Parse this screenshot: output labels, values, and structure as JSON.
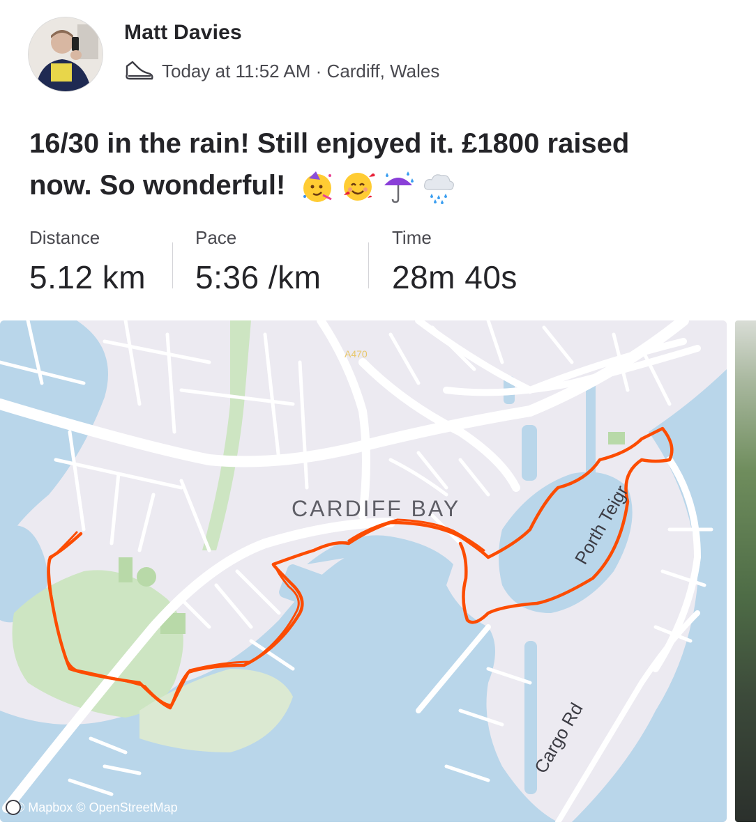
{
  "athlete": {
    "name": "Matt Davies",
    "meta": "Today at 11:52 AM · Cardiff, Wales"
  },
  "activity": {
    "title_line1": "16/30 in the rain! Still enjoyed it. £1800 raised",
    "title_line2": "now. So wonderful!",
    "emojis": [
      "partying-face",
      "smiling-face-with-hearts",
      "umbrella-with-rain-drops",
      "cloud-with-rain"
    ]
  },
  "stats": [
    {
      "label": "Distance",
      "value": "5.12 km"
    },
    {
      "label": "Pace",
      "value": "5:36 /km"
    },
    {
      "label": "Time",
      "value": "28m 40s"
    }
  ],
  "map": {
    "place_label": "CARDIFF BAY",
    "road_labels": {
      "a470": "A470",
      "porth_teigr": "Porth Teigr",
      "cargo_rd": "Cargo Rd"
    },
    "attribution": "© Mapbox © OpenStreetMap",
    "colors": {
      "route": "#fc4c02",
      "water": "#b9d6ea",
      "park": "#cde5c2",
      "land": "#eceaf1",
      "road": "#ffffff"
    }
  }
}
